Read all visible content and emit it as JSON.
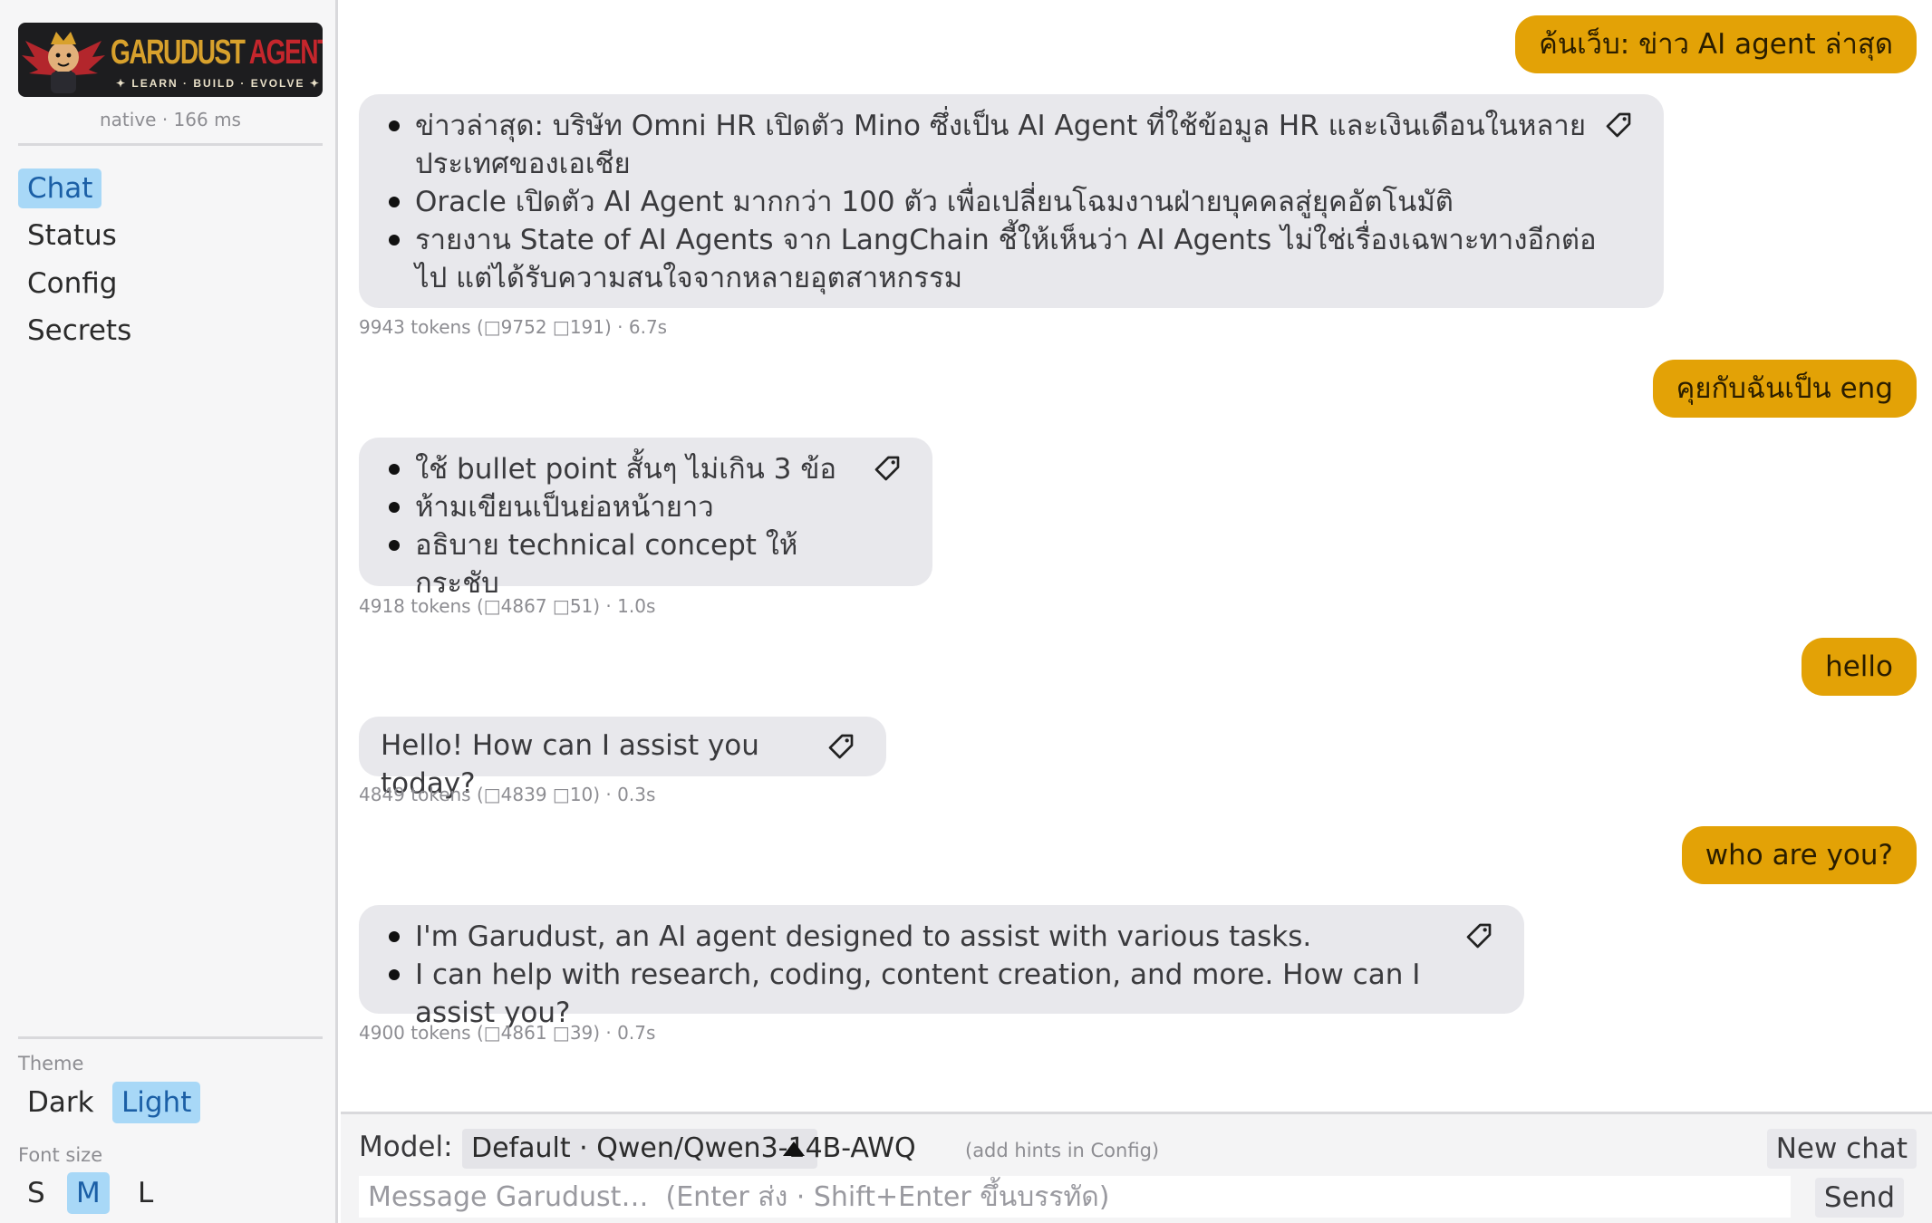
{
  "brand": {
    "name_part1": "GARUDUST",
    "name_part2": "AGENT",
    "tagline": "✦ LEARN · BUILD · EVOLVE ✦"
  },
  "engine_status": "native · 166 ms",
  "nav": {
    "items": [
      "Chat",
      "Status",
      "Config",
      "Secrets"
    ],
    "active": "Chat"
  },
  "theme": {
    "label": "Theme",
    "options": [
      "Dark",
      "Light"
    ],
    "active": "Light"
  },
  "font_size": {
    "label": "Font size",
    "options": [
      "S",
      "M",
      "L"
    ],
    "active": "M"
  },
  "messages": [
    {
      "role": "user",
      "text": "ค้นเว็บ: ข่าว AI agent ล่าสุด"
    },
    {
      "role": "assistant",
      "bullets": [
        "ข่าวล่าสุด: บริษัท Omni HR เปิดตัว Mino ซึ่งเป็น AI Agent ที่ใช้ข้อมูล HR และเงินเดือนในหลายประเทศของเอเชีย",
        "Oracle เปิดตัว AI Agent มากกว่า 100 ตัว เพื่อเปลี่ยนโฉมงานฝ่ายบุคคลสู่ยุคอัตโนมัติ",
        "รายงาน State of AI Agents จาก LangChain ชี้ให้เห็นว่า AI Agents ไม่ใช่เรื่องเฉพาะทางอีกต่อไป แต่ได้รับความสนใจจากหลายอุตสาหกรรม"
      ],
      "meta": "9943 tokens (□9752 □191) · 6.7s"
    },
    {
      "role": "user",
      "text": "คุยกับฉันเป็น eng"
    },
    {
      "role": "assistant",
      "bullets": [
        "ใช้ bullet point สั้นๆ ไม่เกิน 3 ข้อ",
        "ห้ามเขียนเป็นย่อหน้ายาว",
        "อธิบาย technical concept ให้กระชับ"
      ],
      "meta": "4918 tokens (□4867 □51) · 1.0s"
    },
    {
      "role": "user",
      "text": "hello"
    },
    {
      "role": "assistant",
      "text": "Hello! How can I assist you today?",
      "meta": "4849 tokens (□4839 □10) · 0.3s"
    },
    {
      "role": "user",
      "text": "who are you?"
    },
    {
      "role": "assistant",
      "bullets": [
        "I'm Garudust, an AI agent designed to assist with various tasks.",
        "I can help with research, coding, content creation, and more. How can I assist you?"
      ],
      "meta": "4900 tokens (□4861 □39) · 0.7s"
    }
  ],
  "composer": {
    "model_label": "Model:",
    "model_value": "Default · Qwen/Qwen3-14B-AWQ",
    "hint": "(add hints in Config)",
    "new_chat": "New chat",
    "placeholder": "Message Garudust…  (Enter ส่ง · Shift+Enter ขึ้นบรรทัด)",
    "send": "Send"
  },
  "icons": {
    "bubble_action": "tag-icon",
    "model_caret": "caret-up-icon"
  },
  "colors": {
    "accent_user": "#e3a206",
    "assistant_bg": "#e8e8ec",
    "active_nav": "#a8d8f7"
  }
}
